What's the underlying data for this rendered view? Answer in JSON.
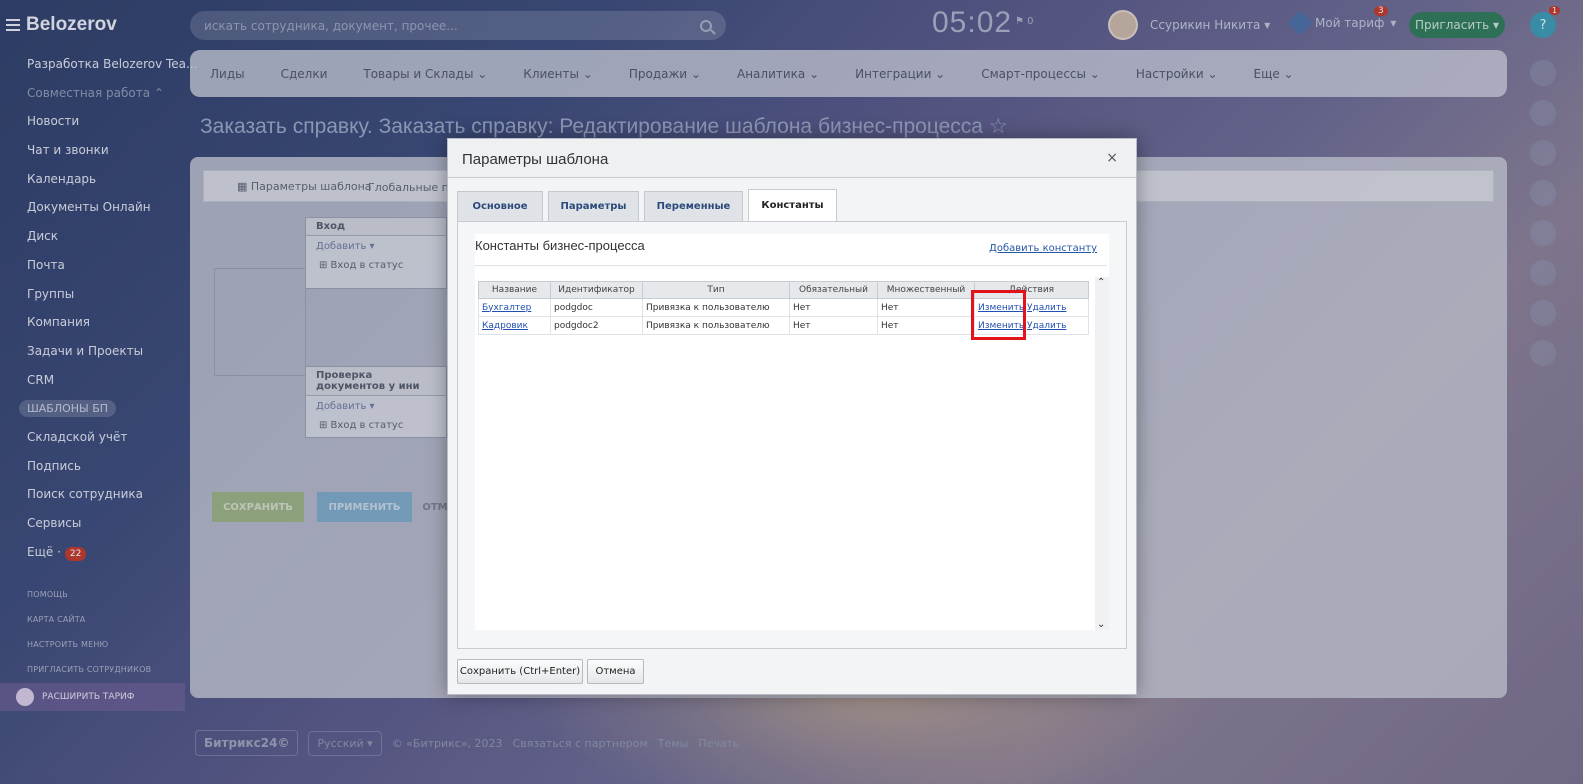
{
  "app": {
    "logo": "Belozerov",
    "search_placeholder": "искать сотрудника, документ, прочее...",
    "clock": "05:02",
    "flag_count": "0",
    "user_name": "Ссурикин Никита",
    "tariff_label": "Мой тариф",
    "tariff_badge": "3",
    "invite_label": "Пригласить",
    "help_label": "?",
    "help_badge": "1"
  },
  "sidebar": {
    "items": [
      {
        "label": "Разработка Belozerov Tea..."
      },
      {
        "label": "Совместная работа ⌃"
      },
      {
        "label": "Новости"
      },
      {
        "label": "Чат и звонки"
      },
      {
        "label": "Календарь"
      },
      {
        "label": "Документы Онлайн"
      },
      {
        "label": "Диск"
      },
      {
        "label": "Почта"
      },
      {
        "label": "Группы"
      },
      {
        "label": "Компания"
      },
      {
        "label": "Задачи и Проекты"
      },
      {
        "label": "CRM"
      },
      {
        "label": "ШАБЛОНЫ БП"
      },
      {
        "label": "Складской учёт"
      },
      {
        "label": "Подпись"
      },
      {
        "label": "Поиск сотрудника"
      },
      {
        "label": "Сервисы"
      },
      {
        "label": "Ещё ·",
        "badge": "22"
      }
    ],
    "sub": [
      "ПОМОЩЬ",
      "КАРТА САЙТА",
      "НАСТРОИТЬ МЕНЮ",
      "ПРИГЛАСИТЬ СОТРУДНИКОВ"
    ],
    "upgrade": "РАСШИРИТЬ ТАРИФ"
  },
  "topnav": [
    "Лиды",
    "Сделки",
    "Товары и Склады ⌄",
    "Клиенты ⌄",
    "Продажи ⌄",
    "Аналитика ⌄",
    "Интеграции ⌄",
    "Смарт-процессы ⌄",
    "Настройки ⌄",
    "Еще ⌄"
  ],
  "page_title": "Заказать справку. Заказать справку: Редактирование шаблона бизнес-процесса ☆",
  "workspace": {
    "tab1": "Параметры шаблона",
    "tab2": "Глобальные пе",
    "box1_title": "Вход",
    "box2_title": "Проверка документов у ини",
    "add": "Добавить ▾",
    "status": "⊞ Вход в статус",
    "save": "СОХРАНИТЬ",
    "apply": "ПРИМЕНИТЬ",
    "cancel": "ОТМ"
  },
  "footer": {
    "brand": "Битрикс24©",
    "lang": "Русский ▾",
    "copyright": "© «Битрикс», 2023",
    "partner": "Связаться с партнером",
    "themes": "Темы",
    "print": "Печать"
  },
  "dialog": {
    "title": "Параметры шаблона",
    "close": "×",
    "tabs": [
      "Основное",
      "Параметры",
      "Переменные",
      "Константы"
    ],
    "section_title": "Константы бизнес-процесса",
    "add_constant": "Добавить константу",
    "columns": [
      "Название",
      "Идентификатор",
      "Тип",
      "Обязательный",
      "Множественный",
      "Действия"
    ],
    "rows": [
      {
        "name": "Бухгалтер",
        "id": "podgdoc",
        "type": "Привязка к пользователю",
        "required": "Нет",
        "multiple": "Нет",
        "edit": "Изменить",
        "delete": "Удалить"
      },
      {
        "name": "Кадровик",
        "id": "podgdoc2",
        "type": "Привязка к пользователю",
        "required": "Нет",
        "multiple": "Нет",
        "edit": "Изменить",
        "delete": "Удалить"
      }
    ],
    "save_button": "Сохранить (Ctrl+Enter)",
    "cancel_button": "Отмена"
  }
}
